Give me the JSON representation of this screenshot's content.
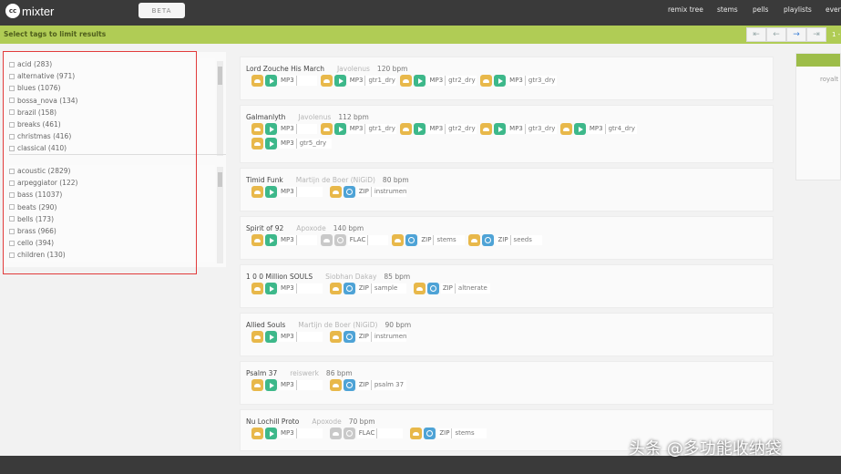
{
  "app": {
    "logo_mark": "cc",
    "logo_text": "mixter",
    "beta_label": "BETA"
  },
  "nav": [
    "remix tree",
    "stems",
    "pells",
    "playlists",
    "even"
  ],
  "toolbar": {
    "filter_label": "Select tags to limit results",
    "page_label": "1 -"
  },
  "tags_top": [
    "acid (283)",
    "alternative (971)",
    "blues (1076)",
    "bossa_nova (134)",
    "brazil (158)",
    "breaks (461)",
    "christmas (416)",
    "classical (410)"
  ],
  "tags_bottom": [
    "acoustic (2829)",
    "arpeggiator (122)",
    "bass (11037)",
    "beats (290)",
    "bells (173)",
    "brass (966)",
    "cello (394)",
    "children (130)"
  ],
  "side": {
    "label": "royalt"
  },
  "tracks": [
    {
      "title": "Lord Zouche His March",
      "artist": "Javolenus",
      "bpm": "120 bpm",
      "rows": [
        [
          {
            "icon": "play",
            "fmt": "MP3",
            "label": ""
          },
          {
            "icon": "play",
            "fmt": "MP3",
            "label": "gtr1_dry"
          },
          {
            "icon": "play",
            "fmt": "MP3",
            "label": "gtr2_dry"
          },
          {
            "icon": "play",
            "fmt": "MP3",
            "label": "gtr3_dry"
          }
        ]
      ]
    },
    {
      "title": "Galmanlyth",
      "artist": "Javolenus",
      "bpm": "112 bpm",
      "rows": [
        [
          {
            "icon": "play",
            "fmt": "MP3",
            "label": ""
          },
          {
            "icon": "play",
            "fmt": "MP3",
            "label": "gtr1_dry"
          },
          {
            "icon": "play",
            "fmt": "MP3",
            "label": "gtr2_dry"
          },
          {
            "icon": "play",
            "fmt": "MP3",
            "label": "gtr3_dry"
          },
          {
            "icon": "play",
            "fmt": "MP3",
            "label": "gtr4_dry"
          }
        ],
        [
          {
            "icon": "play",
            "fmt": "MP3",
            "label": "gtr5_dry"
          }
        ]
      ]
    },
    {
      "title": "Timid Funk",
      "artist": "Martijn de Boer (NiGiD)",
      "bpm": "80 bpm",
      "rows": [
        [
          {
            "icon": "play",
            "fmt": "MP3",
            "label": ""
          },
          {
            "icon": "info",
            "fmt": "ZIP",
            "label": "instrumen"
          }
        ]
      ]
    },
    {
      "title": "Spirit of 92",
      "artist": "Apoxode",
      "bpm": "140 bpm",
      "rows": [
        [
          {
            "icon": "play",
            "fmt": "MP3",
            "label": ""
          },
          {
            "icon": "info-gray",
            "fmt": "FLAC",
            "label": ""
          },
          {
            "icon": "info",
            "fmt": "ZIP",
            "label": "stems"
          },
          {
            "icon": "info",
            "fmt": "ZIP",
            "label": "seeds"
          }
        ]
      ]
    },
    {
      "title": "1 0 0 Million SOULS",
      "artist": "Siobhan Dakay",
      "bpm": "85 bpm",
      "rows": [
        [
          {
            "icon": "play",
            "fmt": "MP3",
            "label": ""
          },
          {
            "icon": "info",
            "fmt": "ZIP",
            "label": "sample"
          },
          {
            "icon": "info",
            "fmt": "ZIP",
            "label": "altnerate"
          }
        ]
      ]
    },
    {
      "title": "Allied Souls",
      "artist": "Martijn de Boer (NiGiD)",
      "bpm": "90 bpm",
      "rows": [
        [
          {
            "icon": "play",
            "fmt": "MP3",
            "label": ""
          },
          {
            "icon": "info",
            "fmt": "ZIP",
            "label": "instrumen"
          }
        ]
      ]
    },
    {
      "title": "Psalm 37",
      "artist": "reiswerk",
      "bpm": "86 bpm",
      "rows": [
        [
          {
            "icon": "play",
            "fmt": "MP3",
            "label": ""
          },
          {
            "icon": "info",
            "fmt": "ZIP",
            "label": "psalm 37"
          }
        ]
      ]
    },
    {
      "title": "Nu Lochill Proto",
      "artist": "Apoxode",
      "bpm": "70 bpm",
      "rows": [
        [
          {
            "icon": "play",
            "fmt": "MP3",
            "label": ""
          },
          {
            "icon": "info-gray",
            "fmt": "FLAC",
            "label": ""
          },
          {
            "icon": "info",
            "fmt": "ZIP",
            "label": "stems"
          }
        ]
      ]
    }
  ],
  "watermark": "头条 @多功能收纳袋"
}
